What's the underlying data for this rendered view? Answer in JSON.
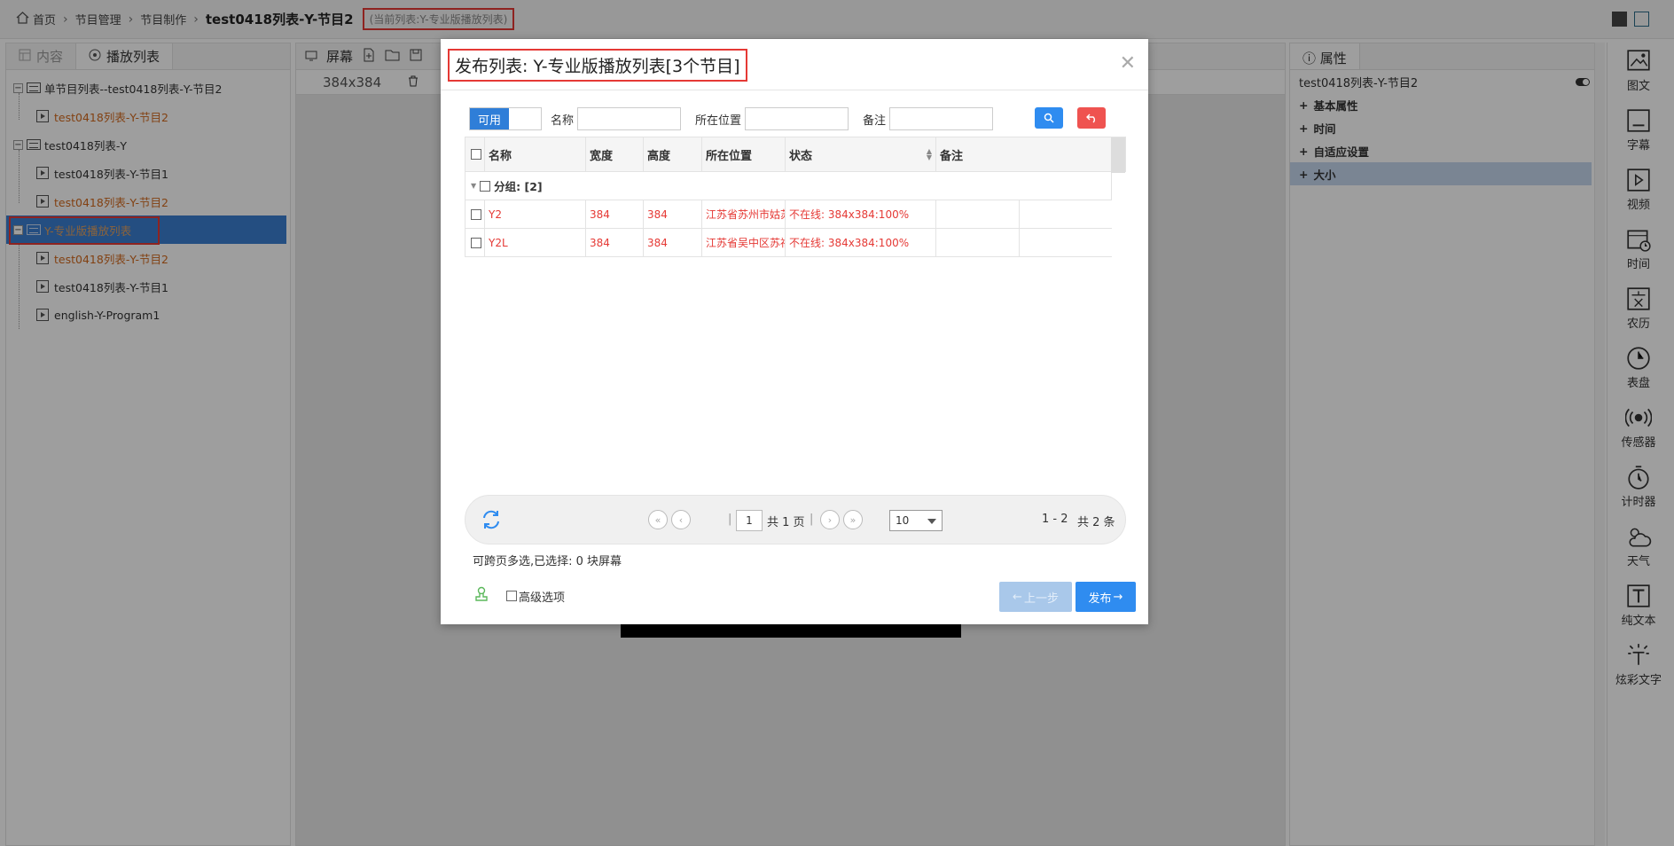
{
  "breadcrumb": {
    "home": "首页",
    "level1": "节目管理",
    "level2": "节目制作",
    "current": "test0418列表-Y-节目2",
    "tag": "(当前列表:Y-专业版播放列表)"
  },
  "left": {
    "tab_content": "内容",
    "tab_playlist": "播放列表",
    "tree": [
      {
        "label": "单节目列表--test0418列表-Y-节目2",
        "level": 0
      },
      {
        "label": "test0418列表-Y-节目2",
        "level": 1,
        "orange": true
      },
      {
        "label": "test0418列表-Y",
        "level": 0
      },
      {
        "label": "test0418列表-Y-节目1",
        "level": 1
      },
      {
        "label": "test0418列表-Y-节目2",
        "level": 1,
        "orange": true
      },
      {
        "label": "Y-专业版播放列表",
        "level": 0,
        "selected": true
      },
      {
        "label": "test0418列表-Y-节目2",
        "level": 1,
        "orange": true
      },
      {
        "label": "test0418列表-Y-节目1",
        "level": 1
      },
      {
        "label": "english-Y-Program1",
        "level": 1
      }
    ]
  },
  "middle": {
    "screen_label": "屏幕",
    "size_label": "384x384"
  },
  "right": {
    "tab_props": "属性",
    "prop_title": "test0418列表-Y-节目2",
    "rows": [
      "基本属性",
      "时间",
      "自适应设置",
      "大小"
    ]
  },
  "tools": [
    "图文",
    "字幕",
    "视频",
    "时间",
    "农历",
    "表盘",
    "传感器",
    "计时器",
    "天气",
    "纯文本",
    "炫彩文字"
  ],
  "dialog": {
    "title": "发布列表: Y-专业版播放列表[3个节目]",
    "status_on": "可用",
    "filter_name": "名称",
    "filter_location": "所在位置",
    "filter_remark": "备注",
    "columns": [
      "名称",
      "宽度",
      "高度",
      "所在位置",
      "状态",
      "备注"
    ],
    "group_label": "分组: [2]",
    "rows": [
      {
        "name": "Y2",
        "width": "384",
        "height": "384",
        "location": "江苏省苏州市姑苏",
        "status": "不在线: 384x384:100%",
        "remark": ""
      },
      {
        "name": "Y2L",
        "width": "384",
        "height": "384",
        "location": "江苏省吴中区苏福",
        "status": "不在线: 384x384:100%",
        "remark": ""
      }
    ],
    "pager": {
      "page": "1",
      "total_pages": "共 1 页",
      "page_size": "10",
      "range": "1 - 2",
      "total": "共 2 条"
    },
    "multi_note": "可跨页多选,已选择: 0 块屏幕",
    "advanced": "高级选项",
    "prev": "上一步",
    "publish": "发布"
  }
}
